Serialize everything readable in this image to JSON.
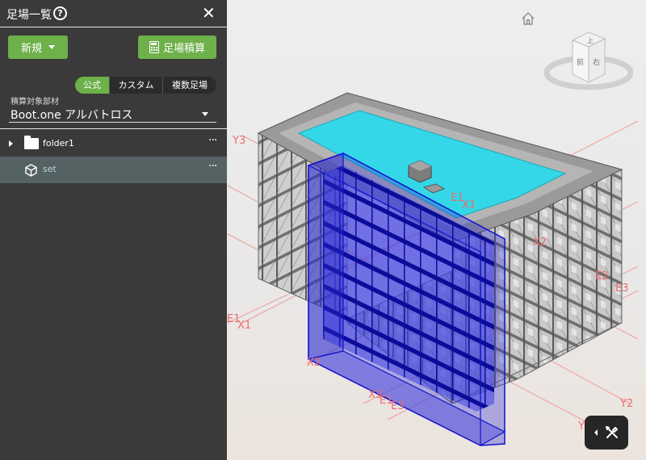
{
  "panel": {
    "title": "足場一覧",
    "help_icon": "?",
    "close_icon": "✕",
    "new_button": "新規",
    "calc_button": "足場積算",
    "tabs": [
      "公式",
      "カスタム",
      "複数足場"
    ],
    "active_tab": "公式",
    "select_label": "積算対象部材",
    "select_value": "Boot.one アルバトロス",
    "tree": [
      {
        "label": "folder1",
        "type": "folder",
        "more": "···"
      },
      {
        "label": "set",
        "type": "set",
        "more": "···"
      }
    ]
  },
  "viewport": {
    "nav_cube": {
      "top": "上",
      "front": "前",
      "right": "右"
    },
    "grid_labels": {
      "y3": "Y3",
      "e1_top": "E1",
      "x1_top": "X1",
      "x2_right": "X2",
      "e2": "E2",
      "e3_right": "E3",
      "e1_left": "E1",
      "x1_left": "X1",
      "x2_bottom": "X2",
      "x3": "X3",
      "e_bottom": "E1",
      "e3_bottom": "E3",
      "y2": "Y2",
      "y_bottom": "Y"
    },
    "colors": {
      "roof": "#34d7e8",
      "selection": "#1f1fd6",
      "grid": "#f08080",
      "scaffold": "#7a7a7a"
    }
  }
}
